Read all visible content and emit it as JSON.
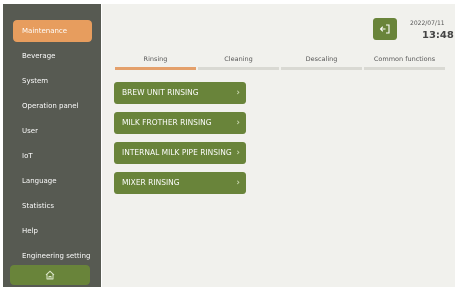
{
  "sidebar": {
    "items": [
      {
        "label": "Maintenance"
      },
      {
        "label": "Beverage"
      },
      {
        "label": "System"
      },
      {
        "label": "Operation panel"
      },
      {
        "label": "User"
      },
      {
        "label": "IoT"
      },
      {
        "label": "Language"
      },
      {
        "label": "Statistics"
      },
      {
        "label": "Help"
      },
      {
        "label": "Engineering setting"
      }
    ]
  },
  "header": {
    "date": "2022/07/11",
    "time": "13:48"
  },
  "tabs": [
    {
      "label": "Rinsing"
    },
    {
      "label": "Cleaning"
    },
    {
      "label": "Descaling"
    },
    {
      "label": "Common functions"
    }
  ],
  "actions": [
    {
      "label": "BREW UNIT RINSING"
    },
    {
      "label": "MILK FROTHER RINSING"
    },
    {
      "label": "INTERNAL MILK PIPE RINSING"
    },
    {
      "label": "MIXER RINSING"
    }
  ],
  "colors": {
    "sidebar_bg": "#575a52",
    "active_item": "#e79d5e",
    "action_green": "#69843a",
    "tab_active": "#e4a06b"
  },
  "icons": {
    "home": "home-icon",
    "logout": "logout-icon",
    "chevron": "chevron-right-icon"
  }
}
